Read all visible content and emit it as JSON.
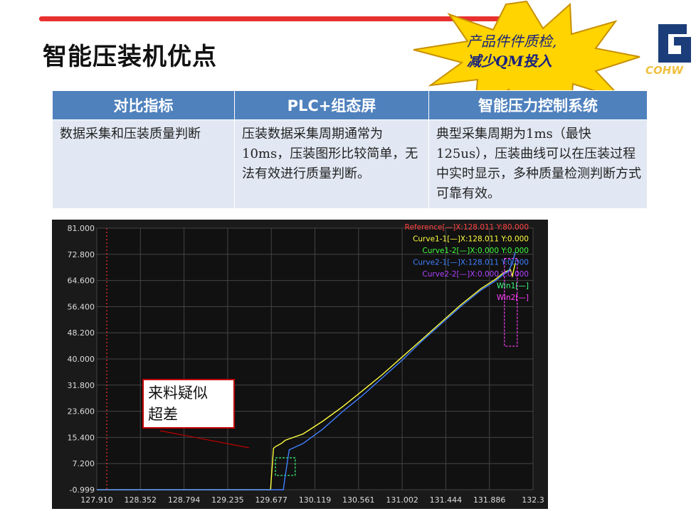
{
  "slide": {
    "title": "智能压装机优点",
    "callout_star": [
      "产品件件质检,",
      "减少QM投入"
    ],
    "logo_text": "COHW"
  },
  "table": {
    "headers": [
      "对比指标",
      "PLC+组态屏",
      "智能压力控制系统"
    ],
    "rows": [
      [
        "数据采集和压装质量判断",
        "压装数据采集周期通常为10ms，压装图形比较简单，无法有效进行质量判断。",
        "典型采集周期为1ms（最快125us），压装曲线可以在压装过程中实时显示，多种质量检测判断方式可靠有效。"
      ]
    ]
  },
  "chart_data": {
    "type": "line",
    "background": "#1a1a1a",
    "y_ticks": [
      "81.000",
      "72.800",
      "64.600",
      "56.400",
      "48.200",
      "40.000",
      "31.800",
      "23.600",
      "15.400",
      "7.200",
      "-0.999"
    ],
    "x_ticks": [
      "127.910",
      "128.352",
      "128.794",
      "129.235",
      "129.677",
      "130.119",
      "130.561",
      "131.002",
      "131.444",
      "131.886",
      "132.3"
    ],
    "ylim": [
      -0.999,
      81.0
    ],
    "xlim": [
      127.91,
      132.33
    ],
    "legend": [
      {
        "label": "Reference[—]X:128.011 Y:80.000",
        "color": "#ff4040"
      },
      {
        "label": "Curve1-1[—]X:128.011 Y:0.000",
        "color": "#ffff40"
      },
      {
        "label": "Curve1-2[—]X:0.000 Y:0.000",
        "color": "#40ff40"
      },
      {
        "label": "Curve2-1[—]X:128.011 Y:0.000",
        "color": "#4080ff"
      },
      {
        "label": "Curve2-2[—]X:0.000 Y:0.000",
        "color": "#b040ff"
      },
      {
        "label": "Win1[—]",
        "color": "#40ff80"
      },
      {
        "label": "Win2[—]",
        "color": "#ff40ff"
      }
    ],
    "series": [
      {
        "name": "Curve1-1",
        "color": "#ffff40",
        "x": [
          127.91,
          129.67,
          129.7,
          129.72,
          129.78,
          129.82,
          130.0,
          130.2,
          130.4,
          130.6,
          130.8,
          131.0,
          131.2,
          131.4,
          131.6,
          131.8,
          131.95,
          132.03,
          132.1,
          132.12,
          132.15
        ],
        "y": [
          -0.999,
          -0.999,
          12.0,
          12.5,
          13.5,
          14.5,
          16.5,
          20.5,
          25.0,
          30.0,
          35.0,
          40.5,
          46.0,
          51.5,
          57.0,
          62.0,
          65.0,
          67.0,
          68.0,
          66.0,
          70.0
        ]
      },
      {
        "name": "Curve2-1",
        "color": "#4080ff",
        "x": [
          127.91,
          129.8,
          129.82,
          129.86,
          130.0,
          130.2,
          130.4,
          130.6,
          130.8,
          131.0,
          131.2,
          131.4,
          131.6,
          131.8,
          131.95,
          132.03,
          132.08,
          132.12,
          132.15
        ],
        "y": [
          -0.999,
          -0.999,
          3.5,
          11.5,
          13.5,
          18.0,
          23.5,
          28.5,
          34.0,
          39.5,
          45.5,
          51.0,
          56.5,
          61.5,
          64.5,
          66.5,
          67.5,
          70.0,
          73.5
        ]
      }
    ],
    "windows": [
      {
        "name": "Win1",
        "color": "#40ff80",
        "x": [
          129.72,
          129.92
        ],
        "y": [
          3.5,
          9.0
        ]
      },
      {
        "name": "Win2",
        "color": "#ff40ff",
        "x": [
          132.04,
          132.17
        ],
        "y": [
          44.0,
          71.5
        ]
      }
    ],
    "reference_x": 128.011
  },
  "callout": {
    "lines": [
      "来料疑似",
      "超差"
    ]
  }
}
